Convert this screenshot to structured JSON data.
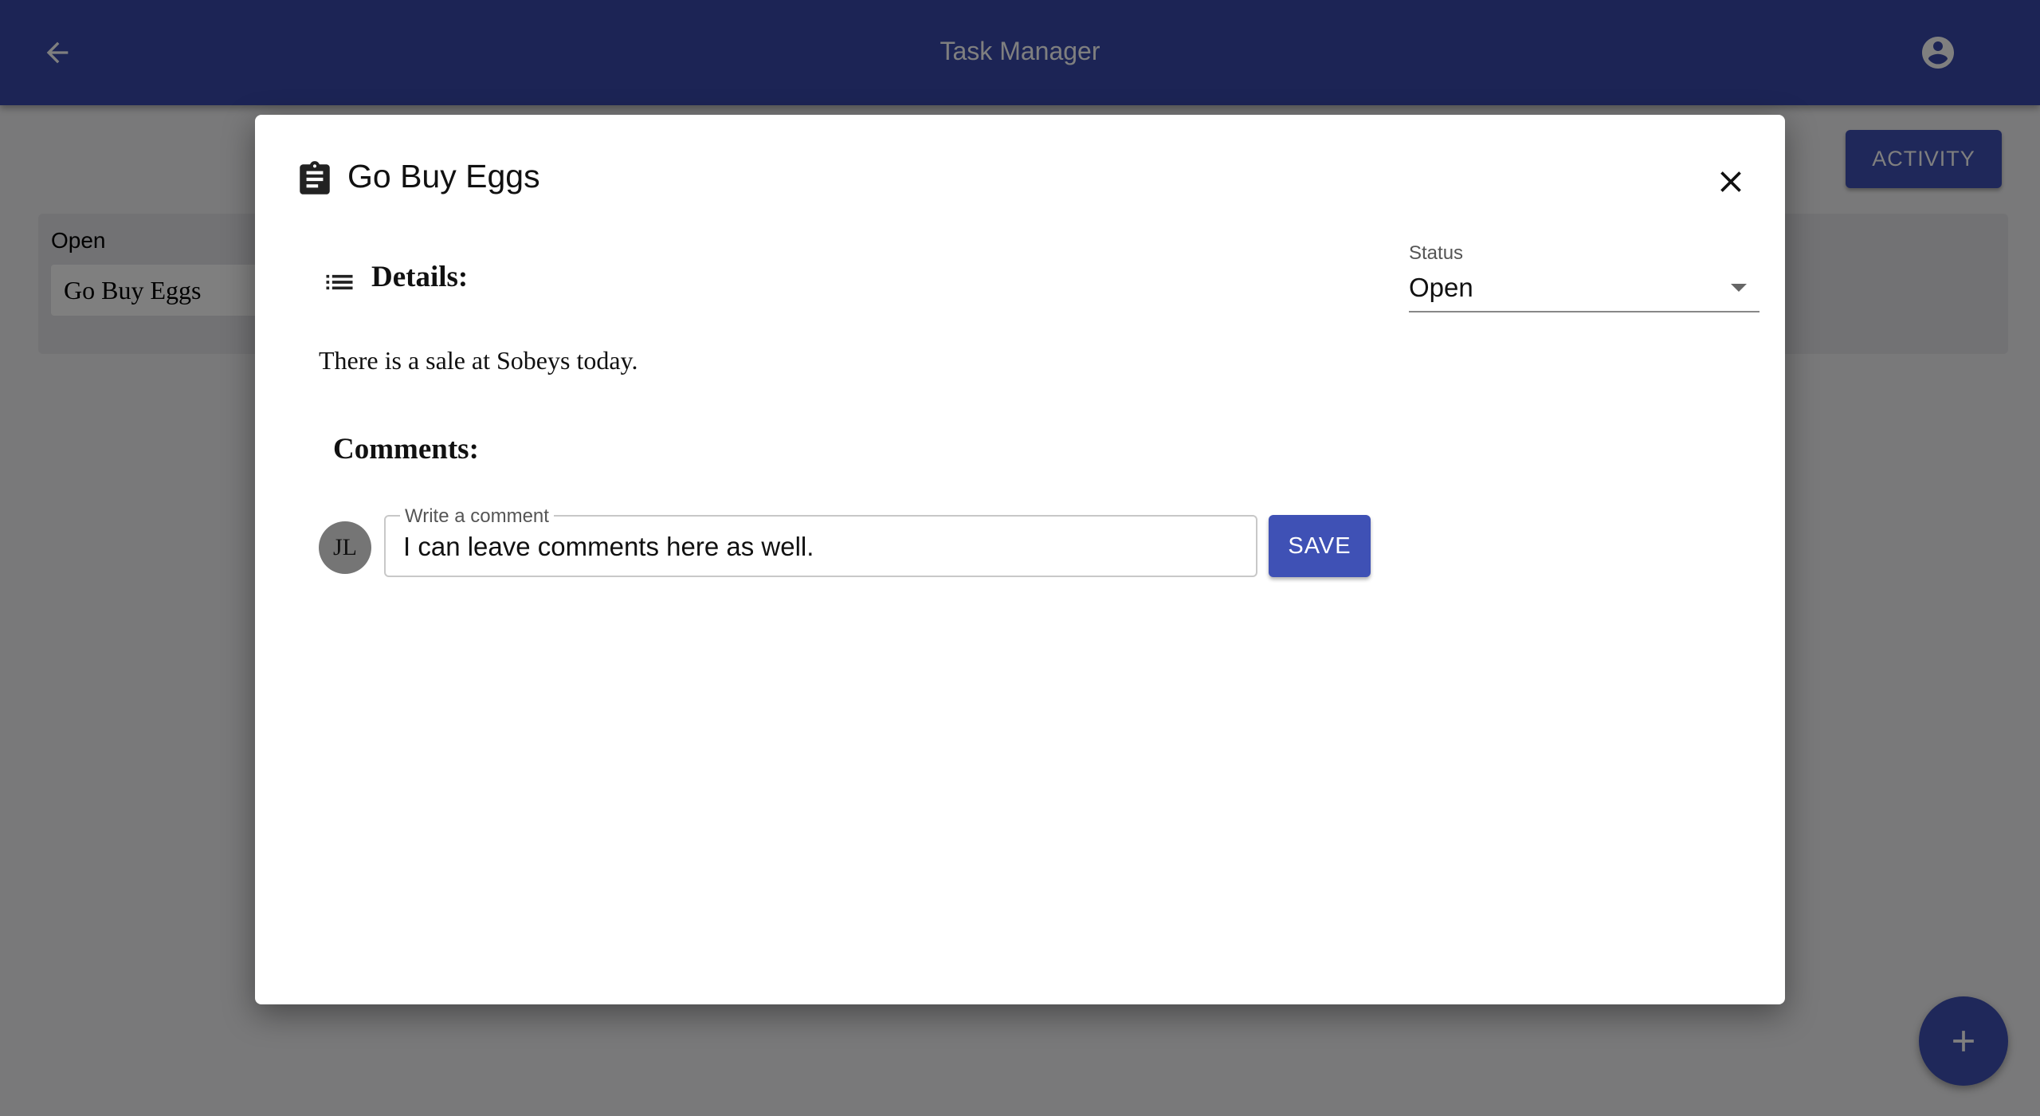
{
  "app": {
    "title": "Task Manager"
  },
  "header": {
    "back_icon": "arrow-back-icon",
    "account_icon": "account-circle-icon"
  },
  "toolbar": {
    "activity_label": "ACTIVITY"
  },
  "board": {
    "columns": [
      {
        "title": "Open",
        "cards": [
          {
            "title": "Go Buy Eggs"
          }
        ]
      }
    ]
  },
  "fab": {
    "icon": "add-icon"
  },
  "dialog": {
    "icon": "assignment-icon",
    "title": "Go Buy Eggs",
    "close_icon": "close-icon",
    "details_icon": "notes-list-icon",
    "details_heading": "Details:",
    "details_text": "There is a sale at Sobeys today.",
    "comments_heading": "Comments:",
    "avatar_initials": "JL",
    "comment_label": "Write a comment",
    "comment_value": "I can leave comments here as well.",
    "save_label": "SAVE",
    "status_label": "Status",
    "status_value": "Open"
  },
  "colors": {
    "primary": "#3f51b5",
    "appbar": "#3949ab",
    "backdrop": "rgba(0,0,0,0.5)"
  }
}
